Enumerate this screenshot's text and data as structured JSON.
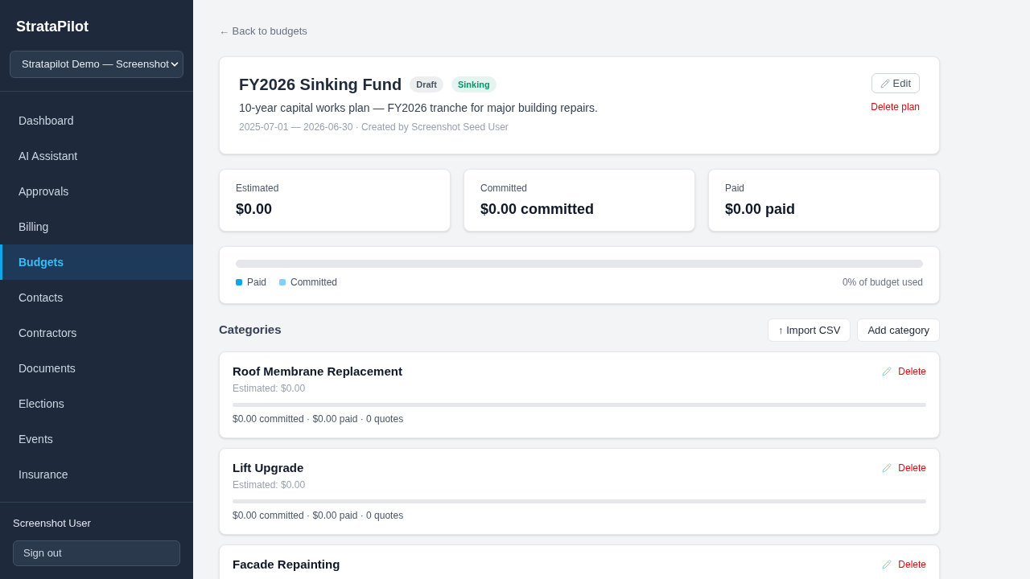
{
  "sidebar": {
    "brand": "StrataPilot",
    "workspace_select": {
      "value": "Stratapilot Demo — Screenshot"
    },
    "items": [
      {
        "label": "Dashboard",
        "selected": false
      },
      {
        "label": "AI Assistant",
        "selected": false
      },
      {
        "label": "Approvals",
        "selected": false
      },
      {
        "label": "Billing",
        "selected": false
      },
      {
        "label": "Budgets",
        "selected": true
      },
      {
        "label": "Contacts",
        "selected": false
      },
      {
        "label": "Contractors",
        "selected": false
      },
      {
        "label": "Documents",
        "selected": false
      },
      {
        "label": "Elections",
        "selected": false
      },
      {
        "label": "Events",
        "selected": false
      },
      {
        "label": "Insurance",
        "selected": false
      }
    ],
    "user": "Screenshot User",
    "sign_out": "Sign out"
  },
  "main": {
    "back_link": "← Back to budgets",
    "plan": {
      "title": "FY2026 Sinking Fund",
      "badges": [
        {
          "label": "Draft",
          "color": "#4b5563"
        },
        {
          "label": "Sinking",
          "color": "#059669"
        }
      ],
      "description": "10-year capital works plan — FY2026 tranche for major building repairs.",
      "meta": "2025-07-01 — 2026-06-30 · Created by Screenshot Seed User",
      "edit": "Edit",
      "delete": "Delete plan"
    },
    "stats": [
      {
        "label": "Estimated",
        "value": "$0.00"
      },
      {
        "label": "Committed",
        "value": "$0.00 committed"
      },
      {
        "label": "Paid",
        "value": "$0.00 paid"
      }
    ],
    "usage": {
      "segments": [
        {
          "label": "Paid",
          "color": "#0ea5e9"
        },
        {
          "label": "Committed",
          "color": "#7dd3fc"
        }
      ],
      "reading": "0% of budget used"
    },
    "categories": {
      "title": "Categories",
      "actions": [
        "↑ Import CSV",
        "Add category"
      ],
      "items": [
        {
          "name": "Roof Membrane Replacement",
          "estimated": "Estimated: $0.00",
          "summary": "$0.00 committed · $0.00 paid · 0 quotes",
          "delete": "Delete"
        },
        {
          "name": "Lift Upgrade",
          "estimated": "Estimated: $0.00",
          "summary": "$0.00 committed · $0.00 paid · 0 quotes",
          "delete": "Delete"
        },
        {
          "name": "Facade Repainting",
          "delete": "Delete"
        }
      ]
    }
  }
}
